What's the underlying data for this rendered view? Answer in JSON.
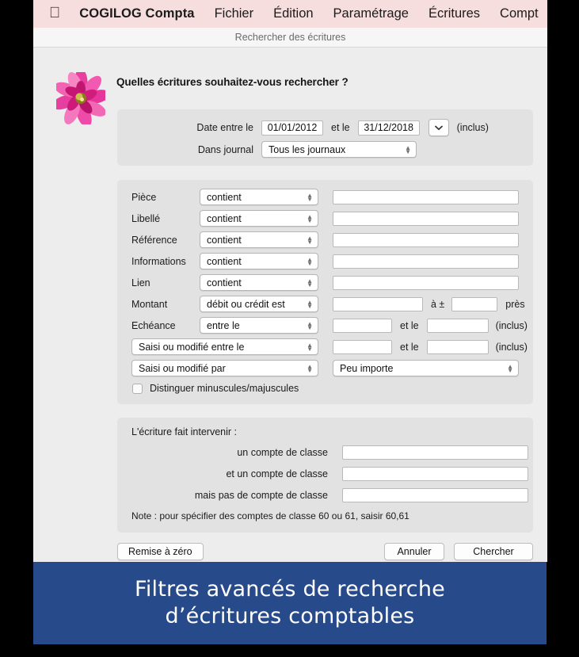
{
  "menubar": {
    "apple_icon": "apple-icon",
    "items": [
      {
        "label": "COGILOG Compta",
        "bold": true
      },
      {
        "label": "Fichier",
        "bold": false
      },
      {
        "label": "Édition",
        "bold": false
      },
      {
        "label": "Paramétrage",
        "bold": false
      },
      {
        "label": "Écritures",
        "bold": false
      },
      {
        "label": "Compt",
        "bold": false
      }
    ],
    "background": "#f7dede"
  },
  "window": {
    "title": "Rechercher des écritures",
    "heading": "Quelles écritures souhaitez-vous rechercher ?",
    "icon": "flower-icon"
  },
  "dates_panel": {
    "date_label": "Date entre le",
    "date_from": "01/01/2012",
    "between_label": "et le",
    "date_to": "31/12/2018",
    "popup_icon": "chevron-down-icon",
    "inclusive_label": "(inclus)",
    "journal_label": "Dans journal",
    "journal_value": "Tous les journaux"
  },
  "criteria_panel": {
    "rows": [
      {
        "label": "Pièce",
        "operator": "contient",
        "value": ""
      },
      {
        "label": "Libellé",
        "operator": "contient",
        "value": ""
      },
      {
        "label": "Référence",
        "operator": "contient",
        "value": ""
      },
      {
        "label": "Informations",
        "operator": "contient",
        "value": ""
      },
      {
        "label": "Lien",
        "operator": "contient",
        "value": ""
      },
      {
        "label": "Montant",
        "operator": "débit ou crédit est",
        "value": ""
      },
      {
        "label": "Echéance",
        "operator": "entre le",
        "value": ""
      }
    ],
    "montant_tolerance_prefix": "à ±",
    "montant_tolerance_value": "",
    "montant_tolerance_suffix": "près",
    "echeance_mid_label": "et le",
    "echeance_to_value": "",
    "echeance_suffix": "(inclus)",
    "saisi_entre_operator": "Saisi ou modifié entre le",
    "saisi_entre_from": "",
    "saisi_entre_mid_label": "et le",
    "saisi_entre_to": "",
    "saisi_entre_suffix": "(inclus)",
    "saisi_par_operator": "Saisi ou modifié par",
    "saisi_par_value": "Peu importe",
    "case_checkbox_label": "Distinguer minuscules/majuscules",
    "case_checkbox_checked": false
  },
  "accounts_panel": {
    "title": "L'écriture fait intervenir :",
    "rows": [
      {
        "label": "un compte de classe",
        "value": ""
      },
      {
        "label": "et un compte de classe",
        "value": ""
      },
      {
        "label": "mais pas de compte de classe",
        "value": ""
      }
    ],
    "note": "Note : pour spécifier des comptes de classe 60 ou 61, saisir 60,61"
  },
  "buttons": {
    "reset": "Remise à zéro",
    "cancel": "Annuler",
    "search": "Chercher"
  },
  "banner": {
    "line1": "Filtres avancés de recherche",
    "line2": "d’écritures comptables",
    "background": "#274a8a"
  }
}
